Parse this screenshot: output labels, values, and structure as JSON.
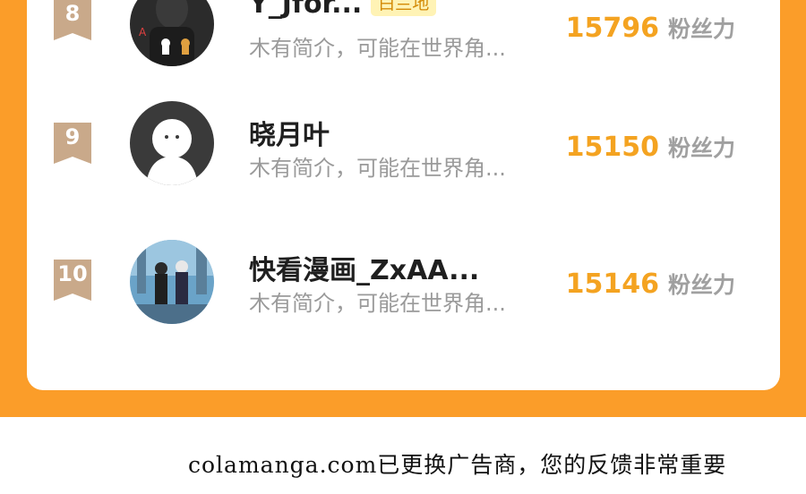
{
  "leaderboard": {
    "rows": [
      {
        "rank": "8",
        "name": "Y_Jfor...",
        "tag": "白兰地",
        "bio": "木有简介，可能在世界角...",
        "fans": "15796",
        "fans_label": "粉丝力",
        "avatar_icon": "dark-photo-avatar-icon"
      },
      {
        "rank": "9",
        "name": "晓月叶",
        "tag": "",
        "bio": "木有简介，可能在世界角...",
        "fans": "15150",
        "fans_label": "粉丝力",
        "avatar_icon": "default-user-avatar-icon"
      },
      {
        "rank": "10",
        "name": "快看漫画_ZxAA...",
        "tag": "",
        "bio": "木有简介，可能在世界角...",
        "fans": "15146",
        "fans_label": "粉丝力",
        "avatar_icon": "anime-art-avatar-icon"
      }
    ],
    "colors": {
      "orange_bg": "#fb9d29",
      "rank_badge": "#c9a98a",
      "fans_number": "#f4a321",
      "tag_bg": "#fff3b5"
    }
  },
  "footer": {
    "text": "colamanga.com已更换广告商，您的反馈非常重要"
  }
}
